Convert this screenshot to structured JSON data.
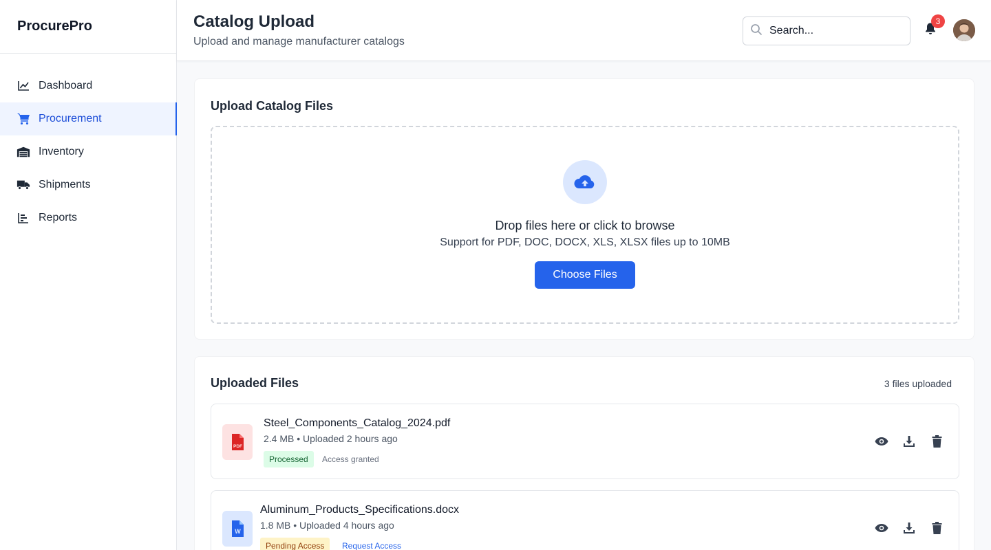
{
  "app": {
    "name": "ProcurePro"
  },
  "sidebar": {
    "items": [
      {
        "label": "Dashboard",
        "icon": "chart-line-icon"
      },
      {
        "label": "Procurement",
        "icon": "cart-icon",
        "active": true
      },
      {
        "label": "Inventory",
        "icon": "warehouse-icon"
      },
      {
        "label": "Shipments",
        "icon": "truck-icon"
      },
      {
        "label": "Reports",
        "icon": "bar-chart-icon"
      }
    ]
  },
  "header": {
    "title": "Catalog Upload",
    "subtitle": "Upload and manage manufacturer catalogs",
    "search_placeholder": "Search...",
    "notification_count": "3"
  },
  "upload": {
    "title": "Upload Catalog Files",
    "drop_title": "Drop files here or click to browse",
    "drop_sub": "Support for PDF, DOC, DOCX, XLS, XLSX files up to 10MB",
    "button_label": "Choose Files"
  },
  "files": {
    "title": "Uploaded Files",
    "count_label": "3 files uploaded",
    "items": [
      {
        "name": "Steel_Components_Catalog_2024.pdf",
        "meta": "2.4 MB • Uploaded 2 hours ago",
        "status": "Processed",
        "access": "Access granted",
        "type_label": "PDF",
        "icon": "pdf-file-icon"
      },
      {
        "name": "Aluminum_Products_Specifications.docx",
        "meta": "1.8 MB • Uploaded 4 hours ago",
        "status": "Pending Access",
        "access": "Request Access",
        "type_label": "W",
        "icon": "word-file-icon"
      }
    ]
  },
  "colors": {
    "accent": "#2563eb",
    "active_bg": "#eff4ff",
    "danger": "#ef4444"
  }
}
